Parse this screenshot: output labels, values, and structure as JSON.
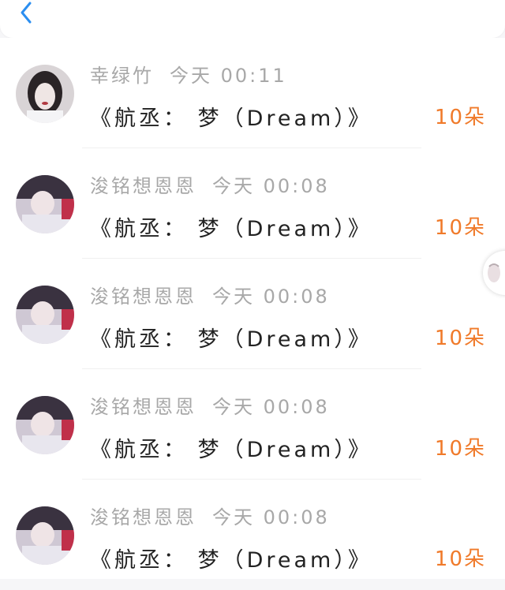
{
  "header": {
    "back_icon": "chevron-left-icon",
    "accent": "#2b8ef0"
  },
  "records": [
    {
      "user": "幸绿竹",
      "time": "今天 00:11",
      "title": "《航丞： 梦（Dream）》",
      "count": "10朵"
    },
    {
      "user": "浚铭想恩恩",
      "time": "今天 00:08",
      "title": "《航丞： 梦（Dream）》",
      "count": "10朵"
    },
    {
      "user": "浚铭想恩恩",
      "time": "今天 00:08",
      "title": "《航丞： 梦（Dream）》",
      "count": "10朵"
    },
    {
      "user": "浚铭想恩恩",
      "time": "今天 00:08",
      "title": "《航丞： 梦（Dream）》",
      "count": "10朵"
    },
    {
      "user": "浚铭想恩恩",
      "time": "今天 00:08",
      "title": "《航丞： 梦（Dream）》",
      "count": "10朵"
    }
  ],
  "colors": {
    "count": "#f07a2a",
    "meta": "#a8a8a8",
    "title": "#222222"
  }
}
